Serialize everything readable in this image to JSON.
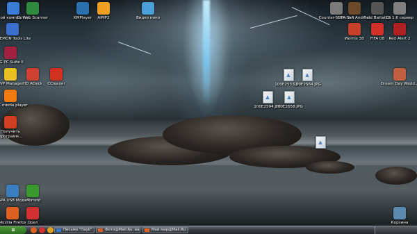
{
  "desktop": {
    "icons": [
      {
        "label": "Мой компьютер",
        "icon": "my-computer-icon",
        "color": "#3a7bd5"
      },
      {
        "label": "Dr.Web Scanner",
        "icon": "drweb-icon",
        "color": "#2e8b3e"
      },
      {
        "label": "KMPlayer",
        "icon": "kmplayer-icon",
        "color": "#2a6fb0"
      },
      {
        "label": "AIMP2",
        "icon": "aimp-icon",
        "color": "#f0a020"
      },
      {
        "label": "Видео кино",
        "icon": "folder-icon",
        "color": "#4a9fd8"
      },
      {
        "label": "Counter-Strike 1.6",
        "icon": "counter-strike-icon",
        "color": "#7a7a7a"
      },
      {
        "label": "GTA San Andreas",
        "icon": "gta-icon",
        "color": "#6b4a2a"
      },
      {
        "label": "Field Battalion",
        "icon": "field-battalion-icon",
        "color": "#555555"
      },
      {
        "label": "CS 1.6 сервер",
        "icon": "cs-server-icon",
        "color": "#808080"
      },
      {
        "label": "DAEMON Tools Lite",
        "icon": "daemon-tools-icon",
        "color": "#3a6fd0"
      },
      {
        "label": "Worms 3D",
        "icon": "worms-icon",
        "color": "#c8402a"
      },
      {
        "label": "FIFA 08",
        "icon": "fifa-icon",
        "color": "#d0302a"
      },
      {
        "label": "Red Alert 2",
        "icon": "red-alert-icon",
        "color": "#b02020"
      },
      {
        "label": "LG PC Suite II",
        "icon": "lg-pc-suite-icon",
        "color": "#a02040"
      },
      {
        "label": "SVP Manager",
        "icon": "svp-manager-icon",
        "color": "#e8c020"
      },
      {
        "label": "HD ADeck",
        "icon": "hd-adeck-icon",
        "color": "#d04030"
      },
      {
        "label": "CCleaner",
        "icon": "ccleaner-icon",
        "color": "#d03020"
      },
      {
        "label": "Dream Day Wedd...",
        "icon": "dream-day-icon",
        "color": "#c06040"
      },
      {
        "label": "VLC media player",
        "icon": "vlc-icon",
        "color": "#f07a10"
      },
      {
        "label": "Получить программ...",
        "icon": "get-programs-icon",
        "color": "#d04020"
      },
      {
        "label": "HSPA USB Модем",
        "icon": "hspa-modem-icon",
        "color": "#3a80c0"
      },
      {
        "label": "uTorrent",
        "icon": "utorrent-icon",
        "color": "#3a9a30"
      },
      {
        "label": "Mozilla Firefox",
        "icon": "firefox-icon",
        "color": "#e06020"
      },
      {
        "label": "Орел",
        "icon": "opera-icon",
        "color": "#d03030"
      },
      {
        "label": "Корзина",
        "icon": "recycle-bin-icon",
        "color": "#5a8ab0"
      }
    ],
    "files": [
      {
        "label": "100E2533.JPG"
      },
      {
        "label": "100E2564.JPG"
      },
      {
        "label": "100E2594.JPG"
      },
      {
        "label": "100E2658.JPG"
      },
      {
        "label": ""
      }
    ]
  },
  "taskbar": {
    "start_icon": "start-button-icon",
    "quick_launch": [
      {
        "icon": "firefox-quicklaunch-icon",
        "color": "#e06020"
      },
      {
        "icon": "opera-quicklaunch-icon",
        "color": "#d03030"
      },
      {
        "icon": "media-quicklaunch-icon",
        "color": "#e0a020"
      }
    ],
    "tasks": [
      {
        "label": "Письмо \"Пауk\"",
        "color": "#3a7bd5"
      },
      {
        "label": "Фото@Mail.Ru: ваш ...",
        "color": "#e06020"
      },
      {
        "label": "Мой мир@Mail.Ru - X...",
        "color": "#e06020"
      }
    ]
  }
}
